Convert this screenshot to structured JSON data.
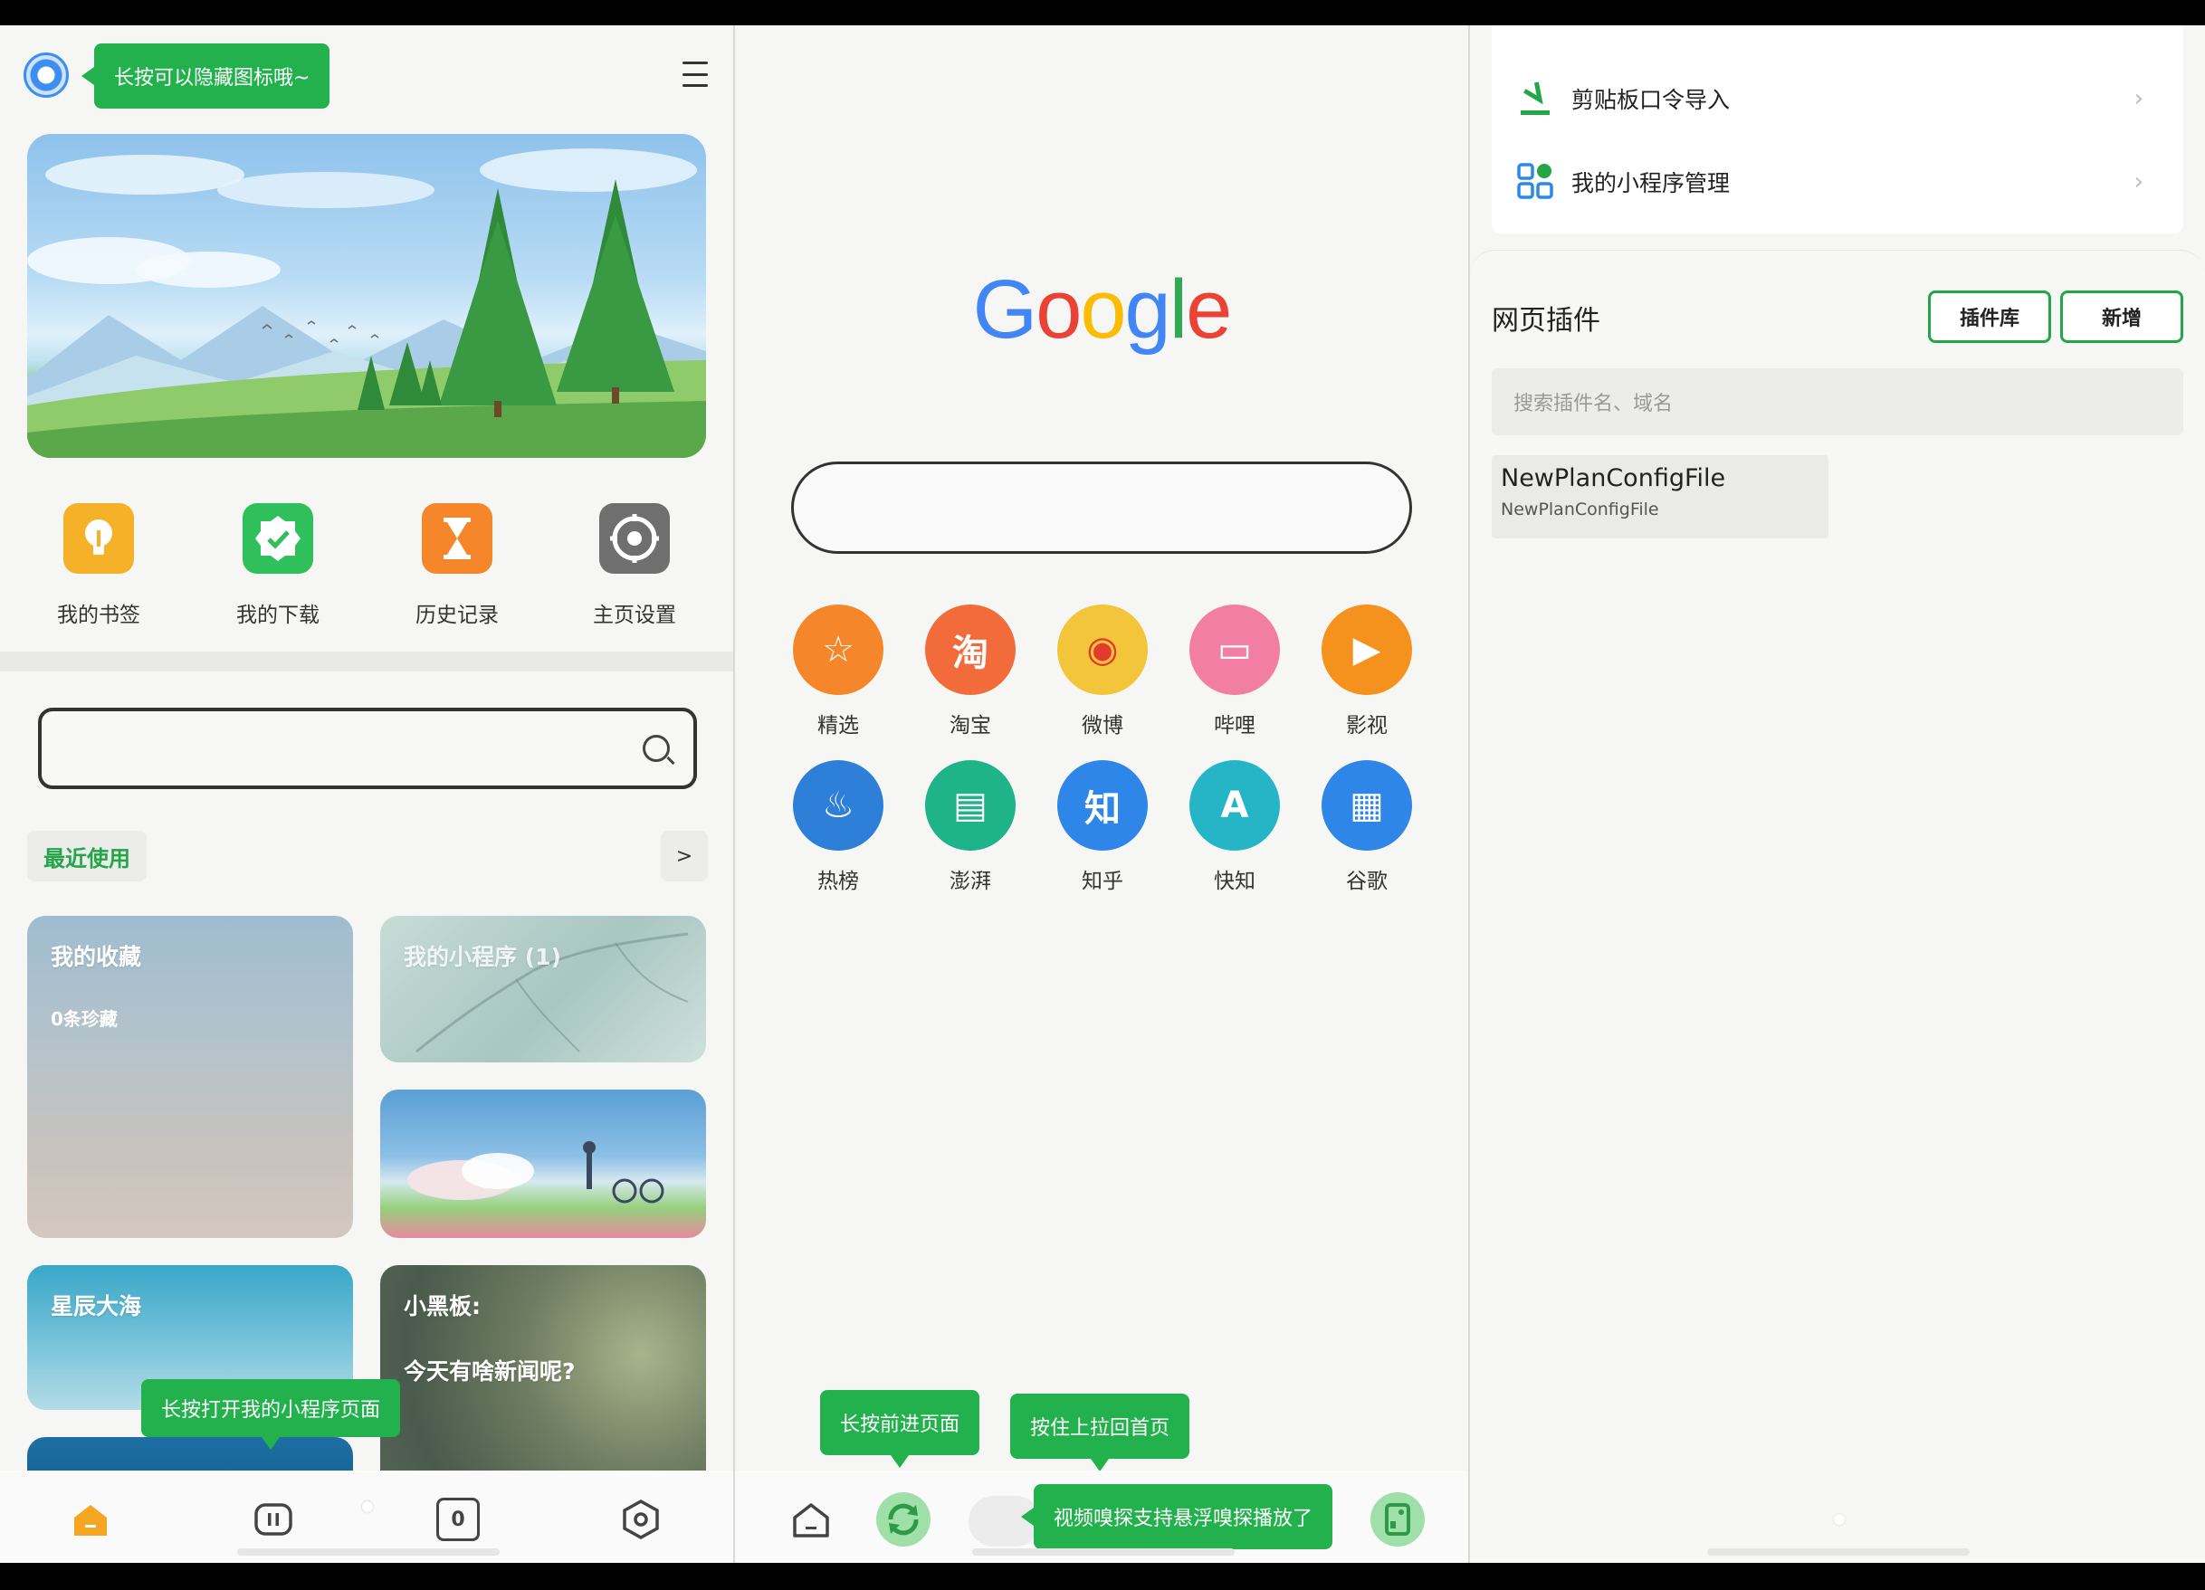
{
  "left": {
    "tooltip_hide_icon": "长按可以隐藏图标哦~",
    "quick_actions": [
      {
        "label": "我的书签",
        "icon": "lightbulb-icon",
        "color": "#f5b228"
      },
      {
        "label": "我的下载",
        "icon": "check-badge-icon",
        "color": "#2fbf5b"
      },
      {
        "label": "历史记录",
        "icon": "hourglass-icon",
        "color": "#f5862a"
      },
      {
        "label": "主页设置",
        "icon": "gear-icon",
        "color": "#6f6f6f"
      }
    ],
    "recent_label": "最近使用",
    "recent_more": ">",
    "cards": {
      "favorites_title": "我的收藏",
      "favorites_sub": "0条珍藏",
      "miniprogram_title": "我的小程序 (1)",
      "stars_title": "星辰大海",
      "blackboard_title": "小黑板:",
      "blackboard_sub": "今天有啥新闻呢?"
    },
    "tooltip_open_mini": "长按打开我的小程序页面",
    "tab_count": "0"
  },
  "middle": {
    "logo": [
      "G",
      "o",
      "o",
      "g",
      "l",
      "e"
    ],
    "logo_colors": [
      "#4285f4",
      "#ea4335",
      "#fbbc05",
      "#4285f4",
      "#34a853",
      "#ea4335"
    ],
    "sites": [
      {
        "label": "精选",
        "glyph": "☆",
        "color": "#f5862a"
      },
      {
        "label": "淘宝",
        "glyph": "淘",
        "color": "#f26b3a"
      },
      {
        "label": "微博",
        "glyph": "◉",
        "color": "#f3c53b"
      },
      {
        "label": "哔哩",
        "glyph": "▭",
        "color": "#f27fa3"
      },
      {
        "label": "影视",
        "glyph": "▶",
        "color": "#f5921e"
      },
      {
        "label": "热榜",
        "glyph": "♨",
        "color": "#2d7fd8"
      },
      {
        "label": "澎湃",
        "glyph": "▤",
        "color": "#1fb38a"
      },
      {
        "label": "知乎",
        "glyph": "知",
        "color": "#2d86e8"
      },
      {
        "label": "快知",
        "glyph": "A",
        "color": "#25b5c6"
      },
      {
        "label": "谷歌",
        "glyph": "▦",
        "color": "#2d86e8"
      }
    ],
    "tooltip_forward": "长按前进页面",
    "tooltip_pullup": "按住上拉回首页",
    "tooltip_sniff": "视频嗅探支持悬浮嗅探播放了"
  },
  "right": {
    "clipboard_import": "剪贴板口令导入",
    "miniprogram_manage": "我的小程序管理",
    "section_title": "网页插件",
    "btn_library": "插件库",
    "btn_add": "新增",
    "search_placeholder": "搜索插件名、域名",
    "plugin_name": "NewPlanConfigFile",
    "plugin_sub": "NewPlanConfigFile"
  }
}
